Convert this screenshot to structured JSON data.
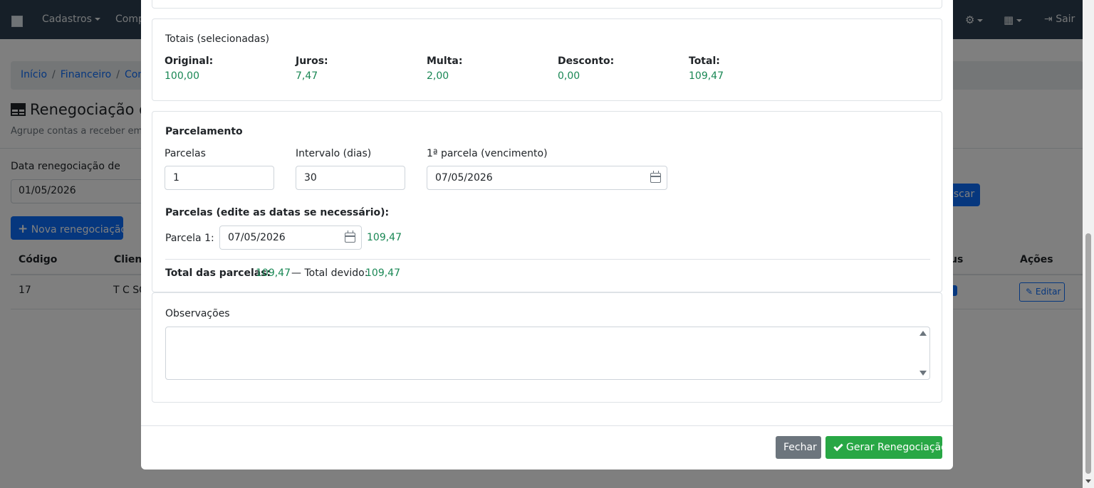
{
  "navbar": {
    "items": [
      {
        "label": "Cadastros",
        "dropdown": true
      },
      {
        "label": "Comp",
        "dropdown": false
      }
    ],
    "logout_label": "Sair",
    "icons": [
      "gear-icon",
      "grid-icon",
      "sign-out-icon"
    ]
  },
  "breadcrumb": [
    "Início",
    "Financeiro",
    "Conta"
  ],
  "page": {
    "title": "Renegociação de",
    "subtitle": "Agrupe contas a receber em u",
    "filter_label": "Data renegociação de",
    "filter_value": "01/05/2026",
    "search_button": "uscar",
    "new_button": "Nova renegociação",
    "table": {
      "headers": [
        "Código",
        "Client",
        "us",
        "Ações"
      ],
      "rows": [
        {
          "codigo": "17",
          "cliente": "T C SC",
          "action": "Editar"
        }
      ]
    }
  },
  "modal": {
    "totals": {
      "title": "Totais (selecionadas)",
      "items": [
        {
          "label": "Original:",
          "value": "100,00"
        },
        {
          "label": "Juros:",
          "value": "7,47"
        },
        {
          "label": "Multa:",
          "value": "2,00"
        },
        {
          "label": "Desconto:",
          "value": "0,00"
        },
        {
          "label": "Total:",
          "value": "109,47"
        }
      ]
    },
    "parcelamento": {
      "title": "Parcelamento",
      "parcelas_label": "Parcelas",
      "parcelas_value": "1",
      "intervalo_label": "Intervalo (dias)",
      "intervalo_value": "30",
      "primeira_label": "1ª parcela (vencimento)",
      "primeira_value": "07/05/2026",
      "edit_title": "Parcelas (edite as datas se necessário):",
      "parcela_label": "Parcela 1:",
      "parcela_date": "07/05/2026",
      "parcela_value": "109,47",
      "total_parcelas_label": "Total das parcelas:",
      "total_parcelas_value": "109,47",
      "total_devido_label": "— Total devido:",
      "total_devido_value": "109,47"
    },
    "observacoes": {
      "label": "Observações",
      "value": ""
    },
    "footer": {
      "close_label": "Fechar",
      "generate_label": "Gerar Renegociação"
    }
  },
  "colors": {
    "navbar": "#2c3e50",
    "primary": "#0d6efd",
    "success_text": "#198754",
    "success_button": "#28a745",
    "secondary_button": "#6c757d"
  }
}
